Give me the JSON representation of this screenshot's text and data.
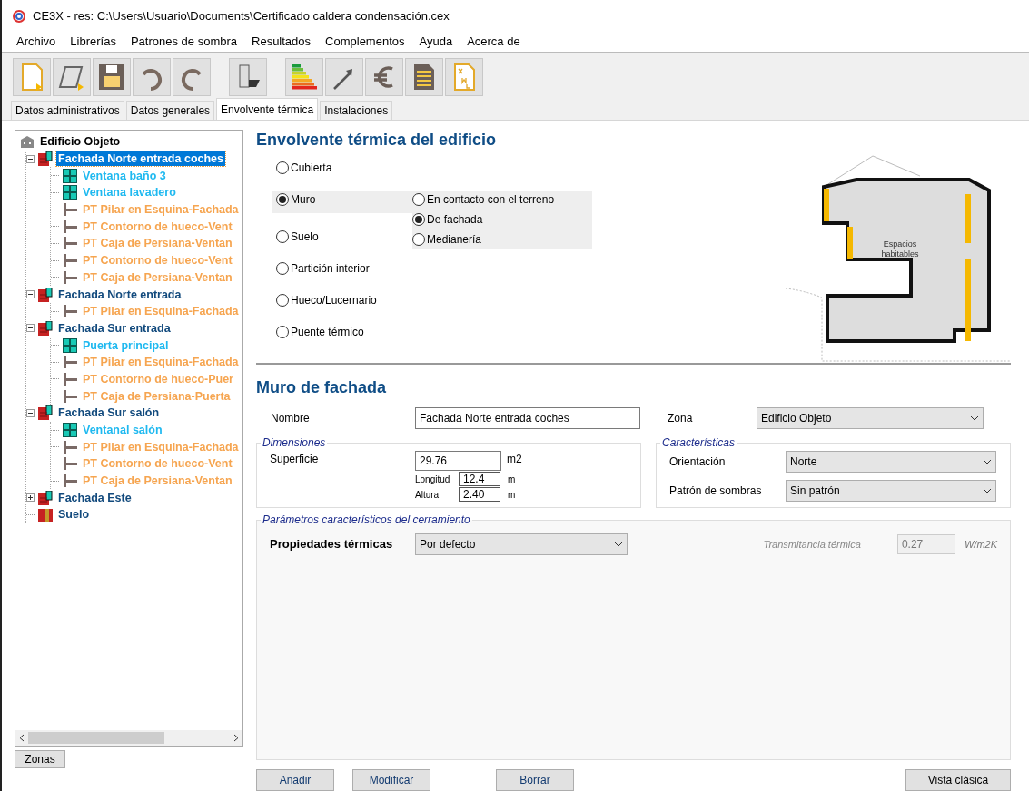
{
  "window": {
    "title": "CE3X - res: C:\\Users\\Usuario\\Documents\\Certificado caldera condensación.cex"
  },
  "menu": [
    "Archivo",
    "Librerías",
    "Patrones de sombra",
    "Resultados",
    "Complementos",
    "Ayuda",
    "Acerca de"
  ],
  "toolbar": [
    {
      "kind": "new"
    },
    {
      "kind": "open"
    },
    {
      "kind": "save"
    },
    {
      "kind": "undo"
    },
    {
      "kind": "redo"
    },
    {
      "kind": "gap"
    },
    {
      "kind": "building"
    },
    {
      "kind": "gap"
    },
    {
      "kind": "rating"
    },
    {
      "kind": "improve"
    },
    {
      "kind": "cost"
    },
    {
      "kind": "report"
    },
    {
      "kind": "xml"
    }
  ],
  "tabs": [
    {
      "label": "Datos administrativos",
      "selected": false
    },
    {
      "label": "Datos generales",
      "selected": false
    },
    {
      "label": "Envolvente térmica",
      "selected": true
    },
    {
      "label": "Instalaciones",
      "selected": false
    }
  ],
  "tree": {
    "root": {
      "label": "Edificio Objeto",
      "kind": "building",
      "children": [
        {
          "label": "Fachada Norte entrada coches",
          "kind": "wall",
          "selected": true,
          "expanded": true,
          "children": [
            {
              "label": "Ventana baño 3",
              "kind": "window",
              "selected": false
            },
            {
              "label": "Ventana lavadero",
              "kind": "window",
              "selected": false
            },
            {
              "label": "PT Pilar en Esquina-Fachada",
              "kind": "bridge",
              "selected": false
            },
            {
              "label": "PT Contorno de hueco-Vent",
              "kind": "bridge",
              "selected": false
            },
            {
              "label": "PT Caja de Persiana-Ventan",
              "kind": "bridge",
              "selected": false
            },
            {
              "label": "PT Contorno de hueco-Vent",
              "kind": "bridge",
              "selected": false
            },
            {
              "label": "PT Caja de Persiana-Ventan",
              "kind": "bridge",
              "selected": false
            }
          ]
        },
        {
          "label": "Fachada Norte entrada",
          "kind": "wall",
          "selected": false,
          "expanded": true,
          "children": [
            {
              "label": "PT Pilar en Esquina-Fachada",
              "kind": "bridge",
              "selected": false
            }
          ]
        },
        {
          "label": "Fachada Sur entrada",
          "kind": "wall",
          "selected": false,
          "expanded": true,
          "children": [
            {
              "label": "Puerta principal",
              "kind": "window",
              "selected": false
            },
            {
              "label": "PT Pilar en Esquina-Fachada",
              "kind": "bridge",
              "selected": false
            },
            {
              "label": "PT Contorno de hueco-Puer",
              "kind": "bridge",
              "selected": false
            },
            {
              "label": "PT Caja de Persiana-Puerta",
              "kind": "bridge",
              "selected": false
            }
          ]
        },
        {
          "label": "Fachada Sur salón",
          "kind": "wall",
          "selected": false,
          "expanded": true,
          "children": [
            {
              "label": "Ventanal salón",
              "kind": "window",
              "selected": false
            },
            {
              "label": "PT Pilar en Esquina-Fachada",
              "kind": "bridge",
              "selected": false
            },
            {
              "label": "PT Contorno de hueco-Vent",
              "kind": "bridge",
              "selected": false
            },
            {
              "label": "PT Caja de Persiana-Ventan",
              "kind": "bridge",
              "selected": false
            }
          ]
        },
        {
          "label": "Fachada Este",
          "kind": "wall",
          "selected": false,
          "expanded": false
        },
        {
          "label": "Suelo",
          "kind": "floor",
          "selected": false
        }
      ]
    }
  },
  "zones_button": "Zonas",
  "envelope": {
    "title": "Envolvente térmica del edificio",
    "options": [
      {
        "label": "Cubierta",
        "selected": false
      },
      {
        "label": "Muro",
        "selected": true,
        "suboptions": [
          {
            "label": "En contacto con el terreno",
            "selected": false
          },
          {
            "label": "De fachada",
            "selected": true
          },
          {
            "label": "Medianería",
            "selected": false
          }
        ]
      },
      {
        "label": "Suelo",
        "selected": false
      },
      {
        "label": "Partición interior",
        "selected": false
      },
      {
        "label": "Hueco/Lucernario",
        "selected": false
      },
      {
        "label": "Puente térmico",
        "selected": false
      }
    ],
    "drawing_label": [
      "Espacios",
      "habitables"
    ]
  },
  "form": {
    "title": "Muro de fachada",
    "name": {
      "label": "Nombre",
      "value": "Fachada Norte entrada coches"
    },
    "zone": {
      "label": "Zona",
      "value": "Edificio Objeto"
    },
    "dimensions": {
      "legend": "Dimensiones",
      "surface": {
        "label": "Superficie",
        "value": "29.76",
        "unit": "m2"
      },
      "length": {
        "label": "Longitud",
        "value": "12.4",
        "unit": "m"
      },
      "height": {
        "label": "Altura",
        "value": "2.40",
        "unit": "m"
      }
    },
    "characteristics": {
      "legend": "Características",
      "orientation": {
        "label": "Orientación",
        "value": "Norte"
      },
      "shadows": {
        "label": "Patrón de sombras",
        "value": "Sin patrón"
      }
    },
    "params": {
      "legend": "Parámetros característicos del cerramiento",
      "thermal": {
        "label": "Propiedades térmicas",
        "value": "Por defecto"
      },
      "transmittance": {
        "label": "Transmitancia térmica",
        "value": "0.27",
        "unit": "W/m2K",
        "disabled": true
      }
    }
  },
  "buttons": [
    "Añadir",
    "Modificar",
    "Borrar"
  ],
  "classic_button": "Vista clásica"
}
